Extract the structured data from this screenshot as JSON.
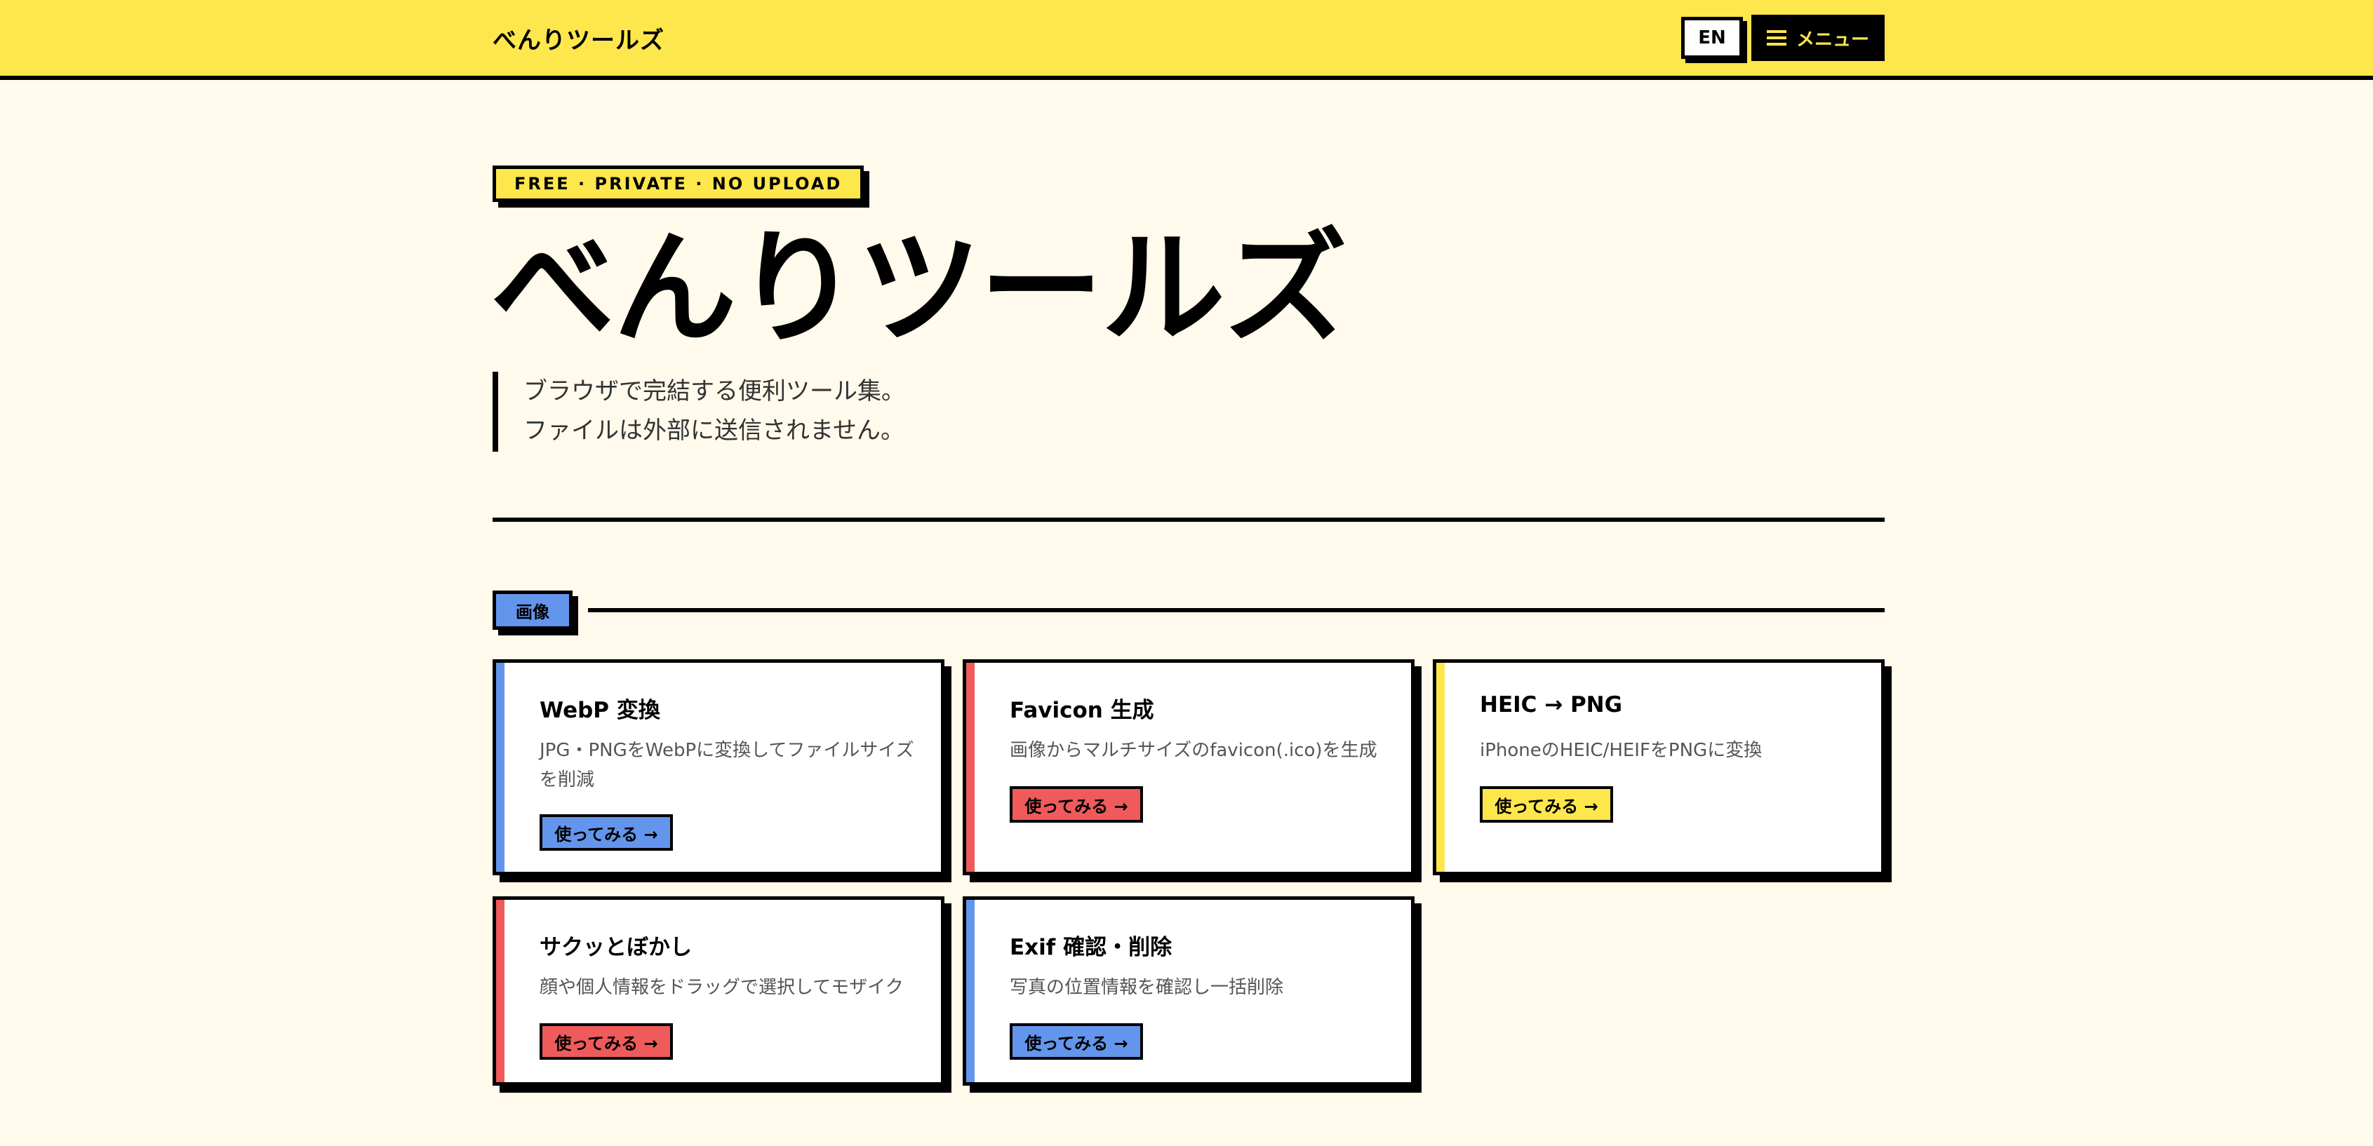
{
  "header": {
    "brand": "べんりツールズ",
    "lang_button": "EN",
    "menu_label": "メニュー"
  },
  "hero": {
    "badge": "FREE · PRIVATE · NO UPLOAD",
    "title": "べんりツールズ",
    "desc_line1": "ブラウザで完結する便利ツール集。",
    "desc_line2": "ファイルは外部に送信されません。"
  },
  "section": {
    "label": "画像"
  },
  "colors": {
    "background": "#fffaeb",
    "header": "#fde74c",
    "blue": "#6495ed",
    "red": "#ef5b5b",
    "yellow": "#fde74c"
  },
  "cards": [
    {
      "title": "WebP 変換",
      "desc": "JPG・PNGをWebPに変換してファイルサイズを削減",
      "button": "使ってみる →",
      "accent": "blue"
    },
    {
      "title": "Favicon 生成",
      "desc": "画像からマルチサイズのfavicon(.ico)を生成",
      "button": "使ってみる →",
      "accent": "red"
    },
    {
      "title": "HEIC → PNG",
      "desc": "iPhoneのHEIC/HEIFをPNGに変換",
      "button": "使ってみる →",
      "accent": "yellow"
    },
    {
      "title": "サクッとぼかし",
      "desc": "顔や個人情報をドラッグで選択してモザイク",
      "button": "使ってみる →",
      "accent": "red"
    },
    {
      "title": "Exif 確認・削除",
      "desc": "写真の位置情報を確認し一括削除",
      "button": "使ってみる →",
      "accent": "blue"
    }
  ]
}
